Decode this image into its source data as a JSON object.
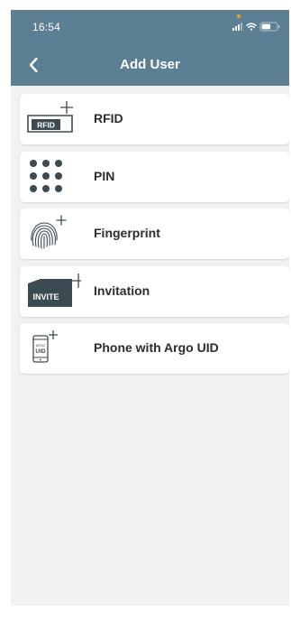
{
  "status_bar": {
    "time": "16:54",
    "icons": [
      "signal-icon",
      "wifi-icon",
      "battery-icon"
    ]
  },
  "nav": {
    "back_icon": "chevron-left-icon",
    "title": "Add User"
  },
  "colors": {
    "header": "#5d7f93",
    "background": "#f1f1f1",
    "card": "#ffffff",
    "icon_dark": "#3c4a51",
    "text": "#2c2c2c"
  },
  "options": [
    {
      "id": "rfid",
      "icon": "rfid-card-add-icon",
      "label": "RFID",
      "icon_text": "RFID"
    },
    {
      "id": "pin",
      "icon": "keypad-dots-icon",
      "label": "PIN"
    },
    {
      "id": "fingerprint",
      "icon": "fingerprint-add-icon",
      "label": "Fingerprint"
    },
    {
      "id": "invitation",
      "icon": "invitation-card-add-icon",
      "label": "Invitation",
      "icon_text": "INVITE"
    },
    {
      "id": "phone-uid",
      "icon": "phone-uid-add-icon",
      "label": "Phone with Argo UID",
      "icon_text_top": "ARGO",
      "icon_text": "UID"
    }
  ]
}
